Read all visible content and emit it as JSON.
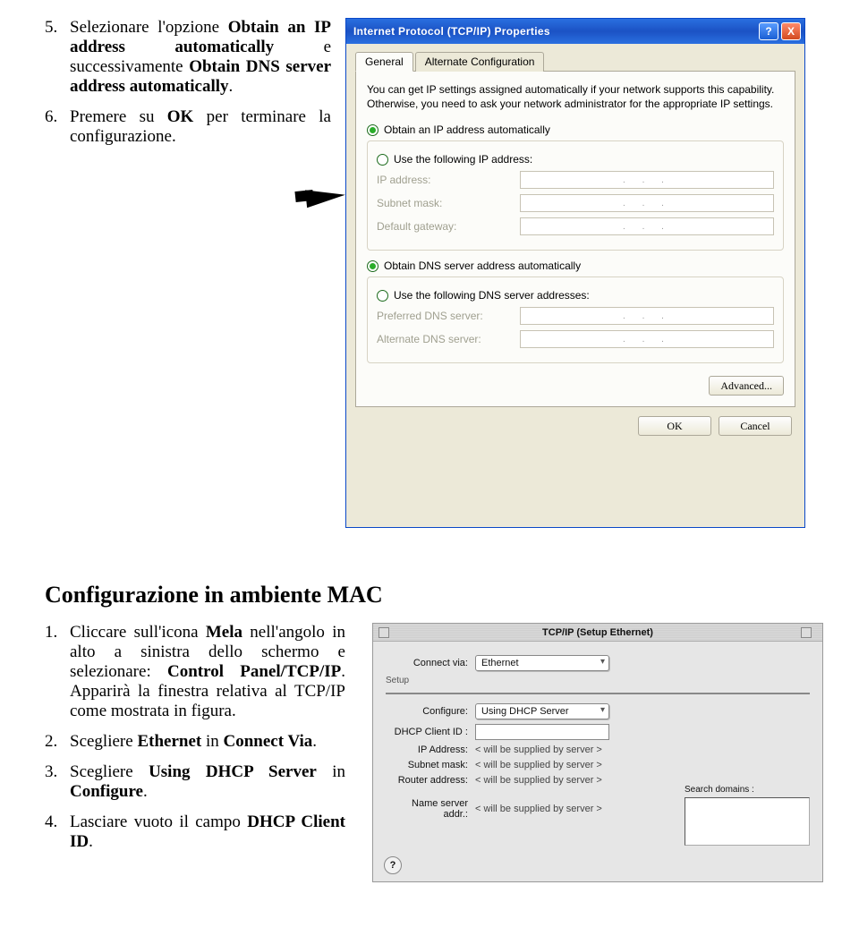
{
  "instructions_top": {
    "item5": {
      "num": "5.",
      "t1": "Selezionare l'opzione ",
      "b1": "Obtain an IP address automatically",
      "t2": " e successivamente ",
      "b2": "Obtain DNS server address automatically",
      "t3": "."
    },
    "item6": {
      "num": "6.",
      "t1": "Premere su ",
      "b1": "OK",
      "t2": " per terminare la configurazione."
    }
  },
  "xp": {
    "title": "Internet Protocol (TCP/IP) Properties",
    "help": "?",
    "close": "X",
    "tab_general": "General",
    "tab_alt": "Alternate Configuration",
    "desc": "You can get IP settings assigned automatically if your network supports this capability. Otherwise, you need to ask your network administrator for the appropriate IP settings.",
    "r_auto_ip": "Obtain an IP address automatically",
    "r_use_ip": "Use the following IP address:",
    "lbl_ip": "IP address:",
    "lbl_mask": "Subnet mask:",
    "lbl_gw": "Default gateway:",
    "r_auto_dns": "Obtain DNS server address automatically",
    "r_use_dns": "Use the following DNS server addresses:",
    "lbl_pdns": "Preferred DNS server:",
    "lbl_adns": "Alternate DNS server:",
    "ip_dots": ".   .   .",
    "adv": "Advanced...",
    "ok": "OK",
    "cancel": "Cancel"
  },
  "mac_section": {
    "heading": "Configurazione in ambiente MAC",
    "item1": {
      "num": "1.",
      "t1": "Cliccare sull'icona ",
      "b1": "Mela",
      "t2": " nell'angolo in alto a sinistra dello schermo e selezionare: ",
      "b2": "Control Panel/TCP/IP",
      "t3": ". Apparirà la finestra relativa al TCP/IP come mostrata in figura."
    },
    "item2": {
      "num": "2.",
      "t1": "Scegliere ",
      "b1": "Ethernet",
      "t2": " in ",
      "b2": "Connect Via",
      "t3": "."
    },
    "item3": {
      "num": "3.",
      "t1": "Scegliere ",
      "b1": "Using DHCP Server",
      "t2": " in ",
      "b2": "Configure",
      "t3": "."
    },
    "item4": {
      "num": "4.",
      "t1": "Lasciare vuoto il campo ",
      "b1": "DHCP Client ID",
      "t2": "."
    }
  },
  "mac": {
    "title": "TCP/IP (Setup Ethernet)",
    "connect_lbl": "Connect via:",
    "connect_val": "Ethernet",
    "setup_lbl": "Setup",
    "configure_lbl": "Configure:",
    "configure_val": "Using DHCP Server",
    "dhcp_lbl": "DHCP Client ID :",
    "ip_lbl": "IP Address:",
    "mask_lbl": "Subnet mask:",
    "router_lbl": "Router address:",
    "ns_lbl": "Name server addr.:",
    "supplied": "< will be supplied by server >",
    "search_lbl": "Search domains :",
    "qmark": "?"
  }
}
